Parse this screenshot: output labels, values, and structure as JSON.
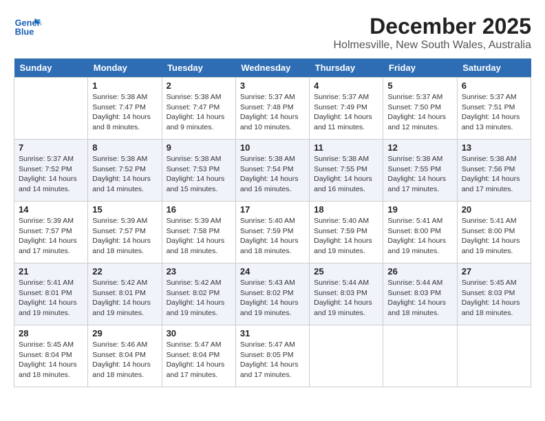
{
  "logo": {
    "line1": "General",
    "line2": "Blue"
  },
  "title": "December 2025",
  "location": "Holmesville, New South Wales, Australia",
  "days_of_week": [
    "Sunday",
    "Monday",
    "Tuesday",
    "Wednesday",
    "Thursday",
    "Friday",
    "Saturday"
  ],
  "weeks": [
    [
      {
        "day": "",
        "info": ""
      },
      {
        "day": "1",
        "info": "Sunrise: 5:38 AM\nSunset: 7:47 PM\nDaylight: 14 hours\nand 8 minutes."
      },
      {
        "day": "2",
        "info": "Sunrise: 5:38 AM\nSunset: 7:47 PM\nDaylight: 14 hours\nand 9 minutes."
      },
      {
        "day": "3",
        "info": "Sunrise: 5:37 AM\nSunset: 7:48 PM\nDaylight: 14 hours\nand 10 minutes."
      },
      {
        "day": "4",
        "info": "Sunrise: 5:37 AM\nSunset: 7:49 PM\nDaylight: 14 hours\nand 11 minutes."
      },
      {
        "day": "5",
        "info": "Sunrise: 5:37 AM\nSunset: 7:50 PM\nDaylight: 14 hours\nand 12 minutes."
      },
      {
        "day": "6",
        "info": "Sunrise: 5:37 AM\nSunset: 7:51 PM\nDaylight: 14 hours\nand 13 minutes."
      }
    ],
    [
      {
        "day": "7",
        "info": "Sunrise: 5:37 AM\nSunset: 7:52 PM\nDaylight: 14 hours\nand 14 minutes."
      },
      {
        "day": "8",
        "info": "Sunrise: 5:38 AM\nSunset: 7:52 PM\nDaylight: 14 hours\nand 14 minutes."
      },
      {
        "day": "9",
        "info": "Sunrise: 5:38 AM\nSunset: 7:53 PM\nDaylight: 14 hours\nand 15 minutes."
      },
      {
        "day": "10",
        "info": "Sunrise: 5:38 AM\nSunset: 7:54 PM\nDaylight: 14 hours\nand 16 minutes."
      },
      {
        "day": "11",
        "info": "Sunrise: 5:38 AM\nSunset: 7:55 PM\nDaylight: 14 hours\nand 16 minutes."
      },
      {
        "day": "12",
        "info": "Sunrise: 5:38 AM\nSunset: 7:55 PM\nDaylight: 14 hours\nand 17 minutes."
      },
      {
        "day": "13",
        "info": "Sunrise: 5:38 AM\nSunset: 7:56 PM\nDaylight: 14 hours\nand 17 minutes."
      }
    ],
    [
      {
        "day": "14",
        "info": "Sunrise: 5:39 AM\nSunset: 7:57 PM\nDaylight: 14 hours\nand 17 minutes."
      },
      {
        "day": "15",
        "info": "Sunrise: 5:39 AM\nSunset: 7:57 PM\nDaylight: 14 hours\nand 18 minutes."
      },
      {
        "day": "16",
        "info": "Sunrise: 5:39 AM\nSunset: 7:58 PM\nDaylight: 14 hours\nand 18 minutes."
      },
      {
        "day": "17",
        "info": "Sunrise: 5:40 AM\nSunset: 7:59 PM\nDaylight: 14 hours\nand 18 minutes."
      },
      {
        "day": "18",
        "info": "Sunrise: 5:40 AM\nSunset: 7:59 PM\nDaylight: 14 hours\nand 19 minutes."
      },
      {
        "day": "19",
        "info": "Sunrise: 5:41 AM\nSunset: 8:00 PM\nDaylight: 14 hours\nand 19 minutes."
      },
      {
        "day": "20",
        "info": "Sunrise: 5:41 AM\nSunset: 8:00 PM\nDaylight: 14 hours\nand 19 minutes."
      }
    ],
    [
      {
        "day": "21",
        "info": "Sunrise: 5:41 AM\nSunset: 8:01 PM\nDaylight: 14 hours\nand 19 minutes."
      },
      {
        "day": "22",
        "info": "Sunrise: 5:42 AM\nSunset: 8:01 PM\nDaylight: 14 hours\nand 19 minutes."
      },
      {
        "day": "23",
        "info": "Sunrise: 5:42 AM\nSunset: 8:02 PM\nDaylight: 14 hours\nand 19 minutes."
      },
      {
        "day": "24",
        "info": "Sunrise: 5:43 AM\nSunset: 8:02 PM\nDaylight: 14 hours\nand 19 minutes."
      },
      {
        "day": "25",
        "info": "Sunrise: 5:44 AM\nSunset: 8:03 PM\nDaylight: 14 hours\nand 19 minutes."
      },
      {
        "day": "26",
        "info": "Sunrise: 5:44 AM\nSunset: 8:03 PM\nDaylight: 14 hours\nand 18 minutes."
      },
      {
        "day": "27",
        "info": "Sunrise: 5:45 AM\nSunset: 8:03 PM\nDaylight: 14 hours\nand 18 minutes."
      }
    ],
    [
      {
        "day": "28",
        "info": "Sunrise: 5:45 AM\nSunset: 8:04 PM\nDaylight: 14 hours\nand 18 minutes."
      },
      {
        "day": "29",
        "info": "Sunrise: 5:46 AM\nSunset: 8:04 PM\nDaylight: 14 hours\nand 18 minutes."
      },
      {
        "day": "30",
        "info": "Sunrise: 5:47 AM\nSunset: 8:04 PM\nDaylight: 14 hours\nand 17 minutes."
      },
      {
        "day": "31",
        "info": "Sunrise: 5:47 AM\nSunset: 8:05 PM\nDaylight: 14 hours\nand 17 minutes."
      },
      {
        "day": "",
        "info": ""
      },
      {
        "day": "",
        "info": ""
      },
      {
        "day": "",
        "info": ""
      }
    ]
  ]
}
